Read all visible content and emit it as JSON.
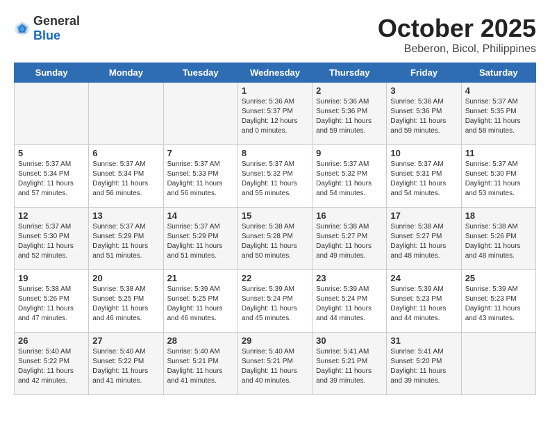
{
  "logo": {
    "text_general": "General",
    "text_blue": "Blue"
  },
  "title": "October 2025",
  "location": "Beberon, Bicol, Philippines",
  "days_of_week": [
    "Sunday",
    "Monday",
    "Tuesday",
    "Wednesday",
    "Thursday",
    "Friday",
    "Saturday"
  ],
  "weeks": [
    [
      {
        "day": "",
        "info": ""
      },
      {
        "day": "",
        "info": ""
      },
      {
        "day": "",
        "info": ""
      },
      {
        "day": "1",
        "info": "Sunrise: 5:36 AM\nSunset: 5:37 PM\nDaylight: 12 hours\nand 0 minutes."
      },
      {
        "day": "2",
        "info": "Sunrise: 5:36 AM\nSunset: 5:36 PM\nDaylight: 11 hours\nand 59 minutes."
      },
      {
        "day": "3",
        "info": "Sunrise: 5:36 AM\nSunset: 5:36 PM\nDaylight: 11 hours\nand 59 minutes."
      },
      {
        "day": "4",
        "info": "Sunrise: 5:37 AM\nSunset: 5:35 PM\nDaylight: 11 hours\nand 58 minutes."
      }
    ],
    [
      {
        "day": "5",
        "info": "Sunrise: 5:37 AM\nSunset: 5:34 PM\nDaylight: 11 hours\nand 57 minutes."
      },
      {
        "day": "6",
        "info": "Sunrise: 5:37 AM\nSunset: 5:34 PM\nDaylight: 11 hours\nand 56 minutes."
      },
      {
        "day": "7",
        "info": "Sunrise: 5:37 AM\nSunset: 5:33 PM\nDaylight: 11 hours\nand 56 minutes."
      },
      {
        "day": "8",
        "info": "Sunrise: 5:37 AM\nSunset: 5:32 PM\nDaylight: 11 hours\nand 55 minutes."
      },
      {
        "day": "9",
        "info": "Sunrise: 5:37 AM\nSunset: 5:32 PM\nDaylight: 11 hours\nand 54 minutes."
      },
      {
        "day": "10",
        "info": "Sunrise: 5:37 AM\nSunset: 5:31 PM\nDaylight: 11 hours\nand 54 minutes."
      },
      {
        "day": "11",
        "info": "Sunrise: 5:37 AM\nSunset: 5:30 PM\nDaylight: 11 hours\nand 53 minutes."
      }
    ],
    [
      {
        "day": "12",
        "info": "Sunrise: 5:37 AM\nSunset: 5:30 PM\nDaylight: 11 hours\nand 52 minutes."
      },
      {
        "day": "13",
        "info": "Sunrise: 5:37 AM\nSunset: 5:29 PM\nDaylight: 11 hours\nand 51 minutes."
      },
      {
        "day": "14",
        "info": "Sunrise: 5:37 AM\nSunset: 5:29 PM\nDaylight: 11 hours\nand 51 minutes."
      },
      {
        "day": "15",
        "info": "Sunrise: 5:38 AM\nSunset: 5:28 PM\nDaylight: 11 hours\nand 50 minutes."
      },
      {
        "day": "16",
        "info": "Sunrise: 5:38 AM\nSunset: 5:27 PM\nDaylight: 11 hours\nand 49 minutes."
      },
      {
        "day": "17",
        "info": "Sunrise: 5:38 AM\nSunset: 5:27 PM\nDaylight: 11 hours\nand 48 minutes."
      },
      {
        "day": "18",
        "info": "Sunrise: 5:38 AM\nSunset: 5:26 PM\nDaylight: 11 hours\nand 48 minutes."
      }
    ],
    [
      {
        "day": "19",
        "info": "Sunrise: 5:38 AM\nSunset: 5:26 PM\nDaylight: 11 hours\nand 47 minutes."
      },
      {
        "day": "20",
        "info": "Sunrise: 5:38 AM\nSunset: 5:25 PM\nDaylight: 11 hours\nand 46 minutes."
      },
      {
        "day": "21",
        "info": "Sunrise: 5:39 AM\nSunset: 5:25 PM\nDaylight: 11 hours\nand 46 minutes."
      },
      {
        "day": "22",
        "info": "Sunrise: 5:39 AM\nSunset: 5:24 PM\nDaylight: 11 hours\nand 45 minutes."
      },
      {
        "day": "23",
        "info": "Sunrise: 5:39 AM\nSunset: 5:24 PM\nDaylight: 11 hours\nand 44 minutes."
      },
      {
        "day": "24",
        "info": "Sunrise: 5:39 AM\nSunset: 5:23 PM\nDaylight: 11 hours\nand 44 minutes."
      },
      {
        "day": "25",
        "info": "Sunrise: 5:39 AM\nSunset: 5:23 PM\nDaylight: 11 hours\nand 43 minutes."
      }
    ],
    [
      {
        "day": "26",
        "info": "Sunrise: 5:40 AM\nSunset: 5:22 PM\nDaylight: 11 hours\nand 42 minutes."
      },
      {
        "day": "27",
        "info": "Sunrise: 5:40 AM\nSunset: 5:22 PM\nDaylight: 11 hours\nand 41 minutes."
      },
      {
        "day": "28",
        "info": "Sunrise: 5:40 AM\nSunset: 5:21 PM\nDaylight: 11 hours\nand 41 minutes."
      },
      {
        "day": "29",
        "info": "Sunrise: 5:40 AM\nSunset: 5:21 PM\nDaylight: 11 hours\nand 40 minutes."
      },
      {
        "day": "30",
        "info": "Sunrise: 5:41 AM\nSunset: 5:21 PM\nDaylight: 11 hours\nand 39 minutes."
      },
      {
        "day": "31",
        "info": "Sunrise: 5:41 AM\nSunset: 5:20 PM\nDaylight: 11 hours\nand 39 minutes."
      },
      {
        "day": "",
        "info": ""
      }
    ]
  ]
}
